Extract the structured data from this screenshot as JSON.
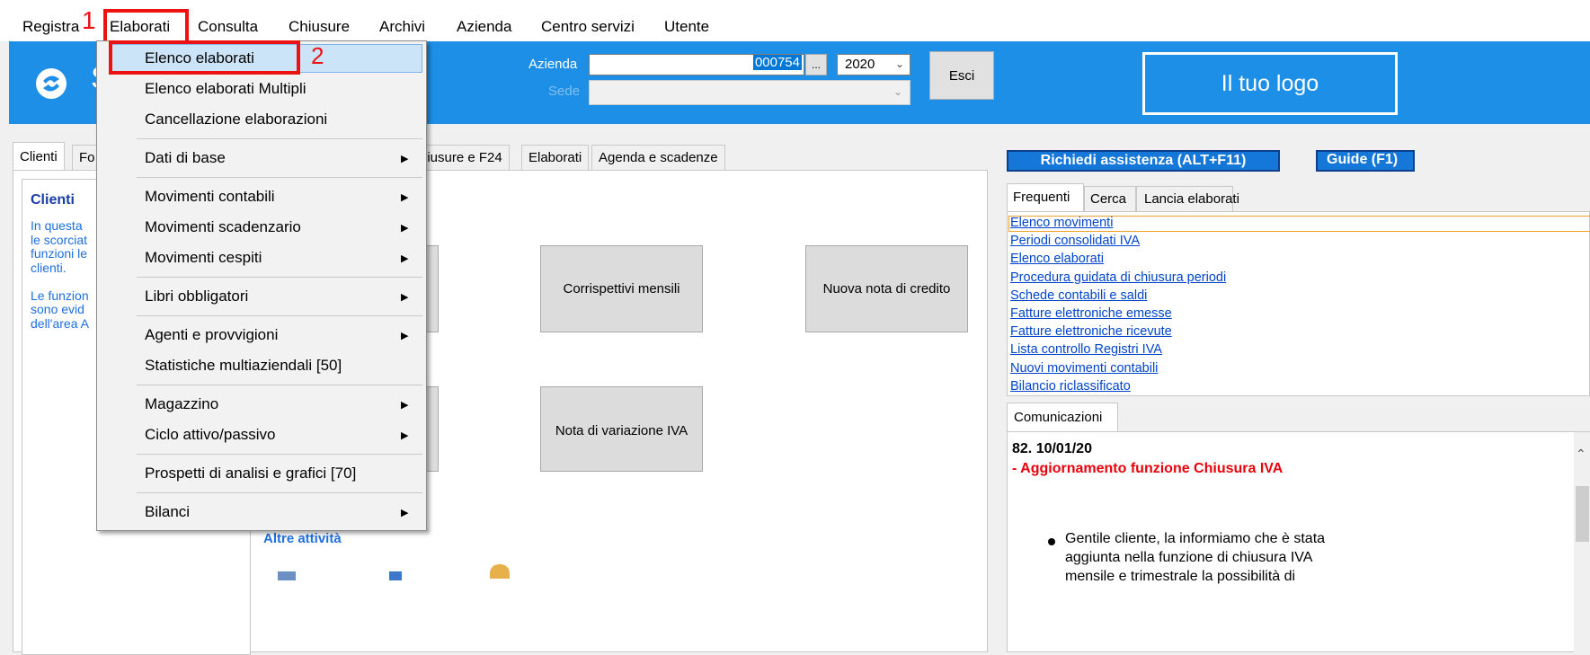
{
  "menubar": {
    "items": [
      "Registra",
      "Elaborati",
      "Consulta",
      "Chiusure",
      "Archivi",
      "Azienda",
      "Centro servizi",
      "Utente"
    ]
  },
  "annotations": {
    "step1": "1",
    "step2": "2"
  },
  "header": {
    "azienda_label": "Azienda",
    "azienda_code": "000754",
    "browse_label": "...",
    "year": "2020",
    "sede_label": "Sede",
    "esci_label": "Esci",
    "logo_text": "Il tuo logo",
    "brand_letter": "S"
  },
  "tabs": [
    "Clienti",
    "Fo",
    "hiusure e F24",
    "Elaborati",
    "Agenda e scadenze"
  ],
  "clienti_panel": {
    "title": "Clienti",
    "lines": [
      "In questa",
      "le scorciat",
      "funzioni le",
      "clienti.",
      "",
      "Le funzion",
      "sono evid",
      "dell'area A"
    ]
  },
  "tiles": {
    "corrispettivi": "Corrispettivi mensili",
    "nuova_nota": "Nuova nota di credito",
    "nota_variazione": "Nota di variazione IVA",
    "partial_glyph": "i"
  },
  "altre_attivita": "Altre attività",
  "right_panel": {
    "assist_button": "Richiedi assistenza  (ALT+F11)",
    "guide_button": "Guide (F1)",
    "tabs": [
      "Frequenti",
      "Cerca",
      "Lancia elaborati"
    ],
    "links": [
      "Elenco movimenti",
      "Periodi consolidati IVA",
      "Elenco elaborati",
      "Procedura guidata di chiusura periodi",
      "Schede contabili e saldi",
      "Fatture elettroniche emesse",
      "Fatture elettroniche ricevute",
      "Lista controllo Registri IVA",
      "Nuovi movimenti contabili",
      "Bilancio riclassificato"
    ],
    "comunicazioni_tab": "Comunicazioni",
    "news_number": "82. 10/01/20",
    "news_title": "- Aggiornamento funzione Chiusura IVA",
    "news_body": [
      "Gentile cliente, la informiamo che è stata",
      "aggiunta nella funzione di chiusura IVA",
      "mensile e trimestrale la possibilità di"
    ]
  },
  "dropdown": {
    "items": [
      {
        "label": "Elenco elaborati",
        "submenu": false
      },
      {
        "label": "Elenco elaborati Multipli",
        "submenu": false
      },
      {
        "label": "Cancellazione elaborazioni",
        "submenu": false
      },
      {
        "label": "Dati di base",
        "submenu": true
      },
      {
        "label": "Movimenti contabili",
        "submenu": true
      },
      {
        "label": "Movimenti scadenzario",
        "submenu": true
      },
      {
        "label": "Movimenti cespiti",
        "submenu": true
      },
      {
        "label": "Libri obbligatori",
        "submenu": true
      },
      {
        "label": "Agenti e provvigioni",
        "submenu": true
      },
      {
        "label": "Statistiche multiaziendali [50]",
        "submenu": false
      },
      {
        "label": "Magazzino",
        "submenu": true
      },
      {
        "label": "Ciclo attivo/passivo",
        "submenu": true
      },
      {
        "label": "Prospetti di analisi e grafici [70]",
        "submenu": false
      },
      {
        "label": "Bilanci",
        "submenu": true
      }
    ]
  },
  "colors": {
    "header_blue": "#1e8fe6",
    "annotation_red": "#ee1111",
    "link_blue": "#0044cc",
    "news_red": "#e8000a",
    "highlight": "#cce4f7"
  }
}
